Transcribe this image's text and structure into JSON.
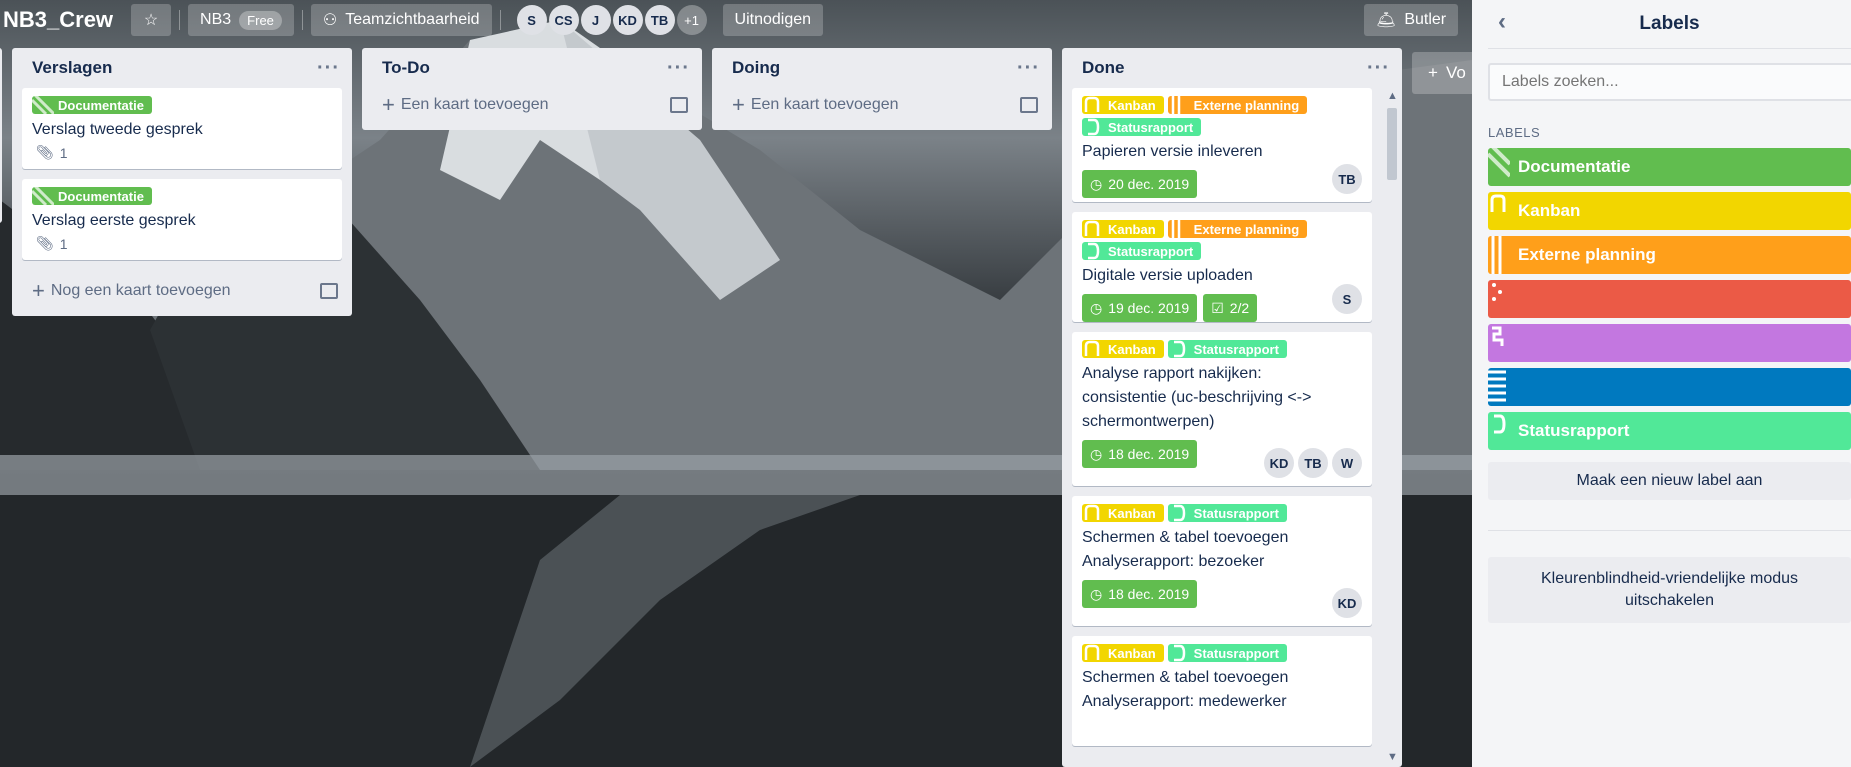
{
  "board": {
    "title": "NB3_Crew",
    "team_label": "NB3",
    "team_badge": "Free",
    "visibility_label": "Teamzichtbaarheid",
    "members": [
      "S",
      "CS",
      "J",
      "KD",
      "TB"
    ],
    "members_more": "+1",
    "invite_label": "Uitnodigen",
    "butler_label": "Butler",
    "add_list_partial": "Vo"
  },
  "lists": {
    "verslagen": {
      "title": "Verslagen",
      "cards": [
        {
          "label": "Documentatie",
          "title": "Verslag tweede gesprek",
          "attachments": "1"
        },
        {
          "label": "Documentatie",
          "title": "Verslag eerste gesprek",
          "attachments": "1"
        }
      ],
      "add_label": "Nog een kaart toevoegen"
    },
    "todo": {
      "title": "To-Do",
      "add_label": "Een kaart toevoegen"
    },
    "doing": {
      "title": "Doing",
      "add_label": "Een kaart toevoegen"
    },
    "done": {
      "title": "Done",
      "cards": [
        {
          "labels": [
            "Kanban",
            "Externe planning",
            "Statusrapport"
          ],
          "title": "Papieren versie inleveren",
          "due": "20 dec. 2019",
          "members": [
            "TB"
          ]
        },
        {
          "labels": [
            "Kanban",
            "Externe planning",
            "Statusrapport"
          ],
          "title": "Digitale versie uploaden",
          "due": "19 dec. 2019",
          "checklist": "2/2",
          "members": [
            "S"
          ]
        },
        {
          "labels": [
            "Kanban",
            "Statusrapport"
          ],
          "title": "Analyse rapport nakijken: consistentie (uc-beschrijving <-> schermontwerpen)",
          "due": "18 dec. 2019",
          "members": [
            "KD",
            "TB",
            "W"
          ]
        },
        {
          "labels": [
            "Kanban",
            "Statusrapport"
          ],
          "title": "Schermen & tabel toevoegen Analyserapport: bezoeker",
          "due": "18 dec. 2019",
          "members": [
            "KD"
          ]
        },
        {
          "labels": [
            "Kanban",
            "Statusrapport"
          ],
          "title": "Schermen & tabel toevoegen Analyserapport: medewerker"
        }
      ]
    }
  },
  "sidebar": {
    "title": "Labels",
    "search_placeholder": "Labels zoeken...",
    "section_heading": "LABELS",
    "labels": [
      {
        "name": "Documentatie",
        "color": "#61bd4f"
      },
      {
        "name": "Kanban",
        "color": "#f2d600"
      },
      {
        "name": "Externe planning",
        "color": "#ff9f1a"
      },
      {
        "name": "",
        "color": "#eb5a46"
      },
      {
        "name": "",
        "color": "#c377e0"
      },
      {
        "name": "",
        "color": "#0079bf"
      },
      {
        "name": "Statusrapport",
        "color": "#51e898"
      }
    ],
    "create_label": "Maak een nieuw label aan",
    "colorblind_toggle": "Kleurenblindheid-vriendelijke modus uitschakelen"
  }
}
